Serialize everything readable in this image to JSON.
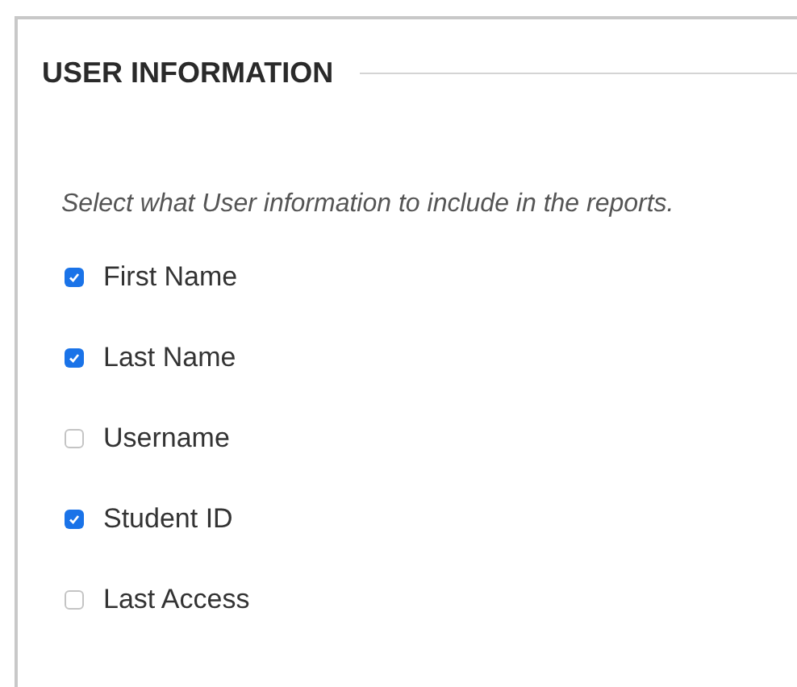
{
  "section": {
    "title": "USER INFORMATION",
    "instructions": "Select what User information to include in the reports.",
    "options": [
      {
        "label": "First Name",
        "checked": true
      },
      {
        "label": "Last Name",
        "checked": true
      },
      {
        "label": "Username",
        "checked": false
      },
      {
        "label": "Student ID",
        "checked": true
      },
      {
        "label": "Last Access",
        "checked": false
      }
    ]
  }
}
